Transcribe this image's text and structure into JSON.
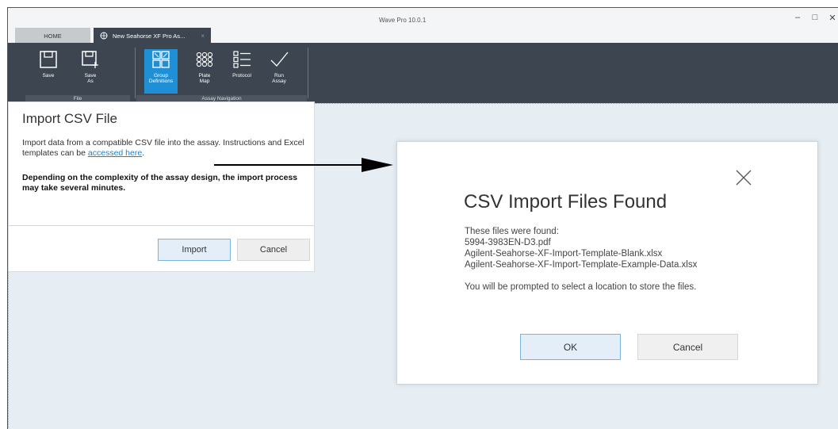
{
  "window": {
    "title": "Wave Pro 10.0.1",
    "controls": {
      "minimize": "–",
      "maximize": "□",
      "close": "✕"
    }
  },
  "tabs": [
    {
      "label": "HOME"
    },
    {
      "label": "New Seahorse XF Pro As...",
      "close": "×"
    }
  ],
  "ribbon": {
    "file_group": {
      "label": "File",
      "buttons": [
        {
          "label": "Save",
          "icon": "save-icon"
        },
        {
          "label_line1": "Save",
          "label_line2": "As",
          "icon": "save-as-icon"
        }
      ]
    },
    "navigation_group": {
      "label": "Assay Navigation",
      "buttons": [
        {
          "label_line1": "Group",
          "label_line2": "Definitions",
          "icon": "group-definitions-icon",
          "active": true
        },
        {
          "label_line1": "Plate",
          "label_line2": "Map",
          "icon": "plate-map-icon"
        },
        {
          "label": "Protocol",
          "icon": "protocol-icon"
        },
        {
          "label_line1": "Run",
          "label_line2": "Assay",
          "icon": "checkmark-icon"
        }
      ]
    },
    "colors": {
      "background": "#3c4550",
      "active": "#1f8fd6"
    }
  },
  "import_dialog": {
    "title": "Import CSV File",
    "description_pre": "Import data from a compatible CSV file into the assay. Instructions and Excel templates can be ",
    "link_text": "accessed here",
    "description_post": ".",
    "warning": "Depending on the complexity of the assay design, the import process may take several minutes.",
    "import_button": "Import",
    "cancel_button": "Cancel"
  },
  "found_dialog": {
    "title": "CSV Import Files Found",
    "intro": "These files were found:",
    "files": [
      "5994-3983EN-D3.pdf",
      "Agilent-Seahorse-XF-Import-Template-Blank.xlsx",
      "Agilent-Seahorse-XF-Import-Template-Example-Data.xlsx"
    ],
    "prompt": "You will be prompted to select a location to store the files.",
    "ok_button": "OK",
    "cancel_button": "Cancel"
  }
}
